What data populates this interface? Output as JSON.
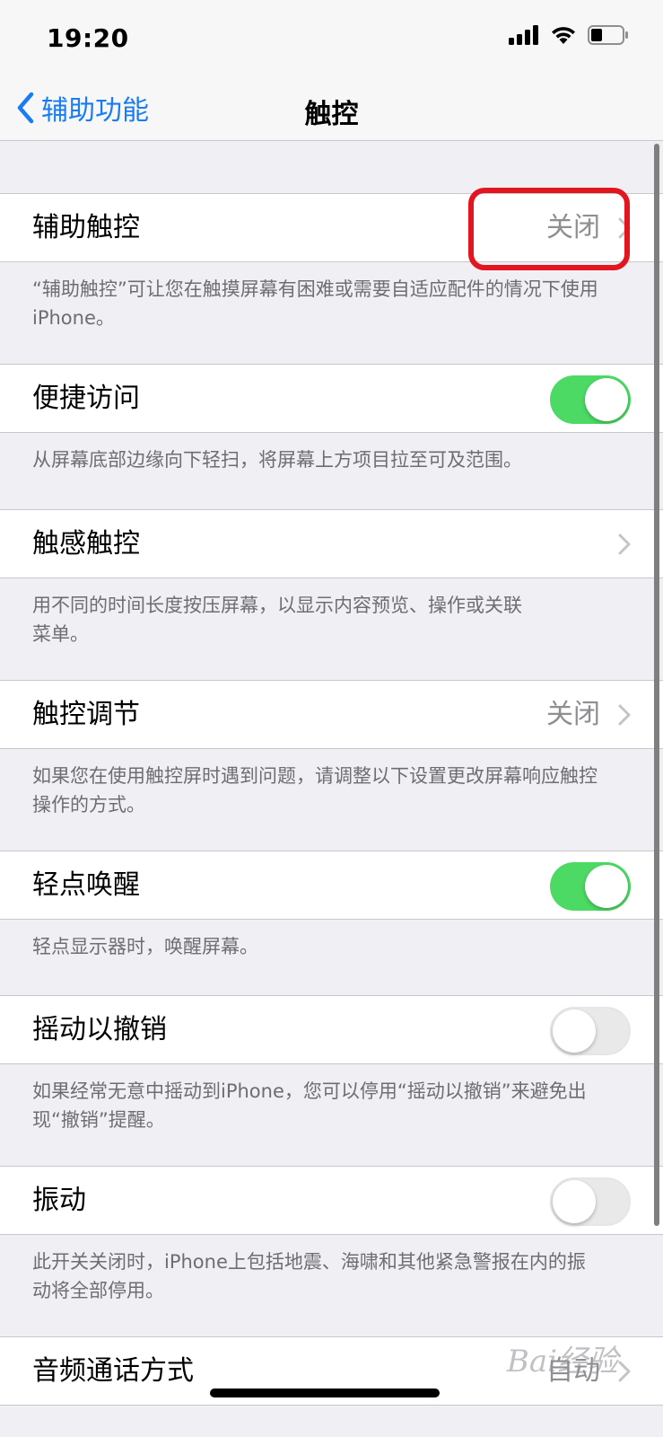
{
  "status_bar": {
    "time": "19:20"
  },
  "nav": {
    "back_label": "辅助功能",
    "title": "触控"
  },
  "sections": [
    {
      "label": "辅助触控",
      "value": "关闭",
      "control": "chevron",
      "footer": "“辅助触控”可让您在触摸屏幕有困难或需要自适应配件的情况下使用iPhone。"
    },
    {
      "label": "便捷访问",
      "control": "toggle",
      "toggle_on": true,
      "footer": "从屏幕底部边缘向下轻扫，将屏幕上方项目拉至可及范围。"
    },
    {
      "label": "触感触控",
      "control": "chevron",
      "footer": "用不同的时间长度按压屏幕，以显示内容预览、操作或关联菜单。"
    },
    {
      "label": "触控调节",
      "value": "关闭",
      "control": "chevron",
      "footer": "如果您在使用触控屏时遇到问题，请调整以下设置更改屏幕响应触控操作的方式。"
    },
    {
      "label": "轻点唤醒",
      "control": "toggle",
      "toggle_on": true,
      "footer": "轻点显示器时，唤醒屏幕。"
    },
    {
      "label": "摇动以撤销",
      "control": "toggle",
      "toggle_on": false,
      "footer": "如果经常无意中摇动到iPhone，您可以停用“摇动以撤销”来避免出现“撤销”提醒。"
    },
    {
      "label": "振动",
      "control": "toggle",
      "toggle_on": false,
      "footer": "此开关关闭时，iPhone上包括地震、海啸和其他紧急警报在内的振动将全部停用。"
    },
    {
      "label": "音频通话方式",
      "value": "自动",
      "control": "chevron"
    }
  ],
  "watermark": "Bai经验",
  "colors": {
    "accent": "#1a7cf2",
    "toggle_on": "#4cd964",
    "highlight": "#e3151f",
    "background": "#efeff4"
  }
}
